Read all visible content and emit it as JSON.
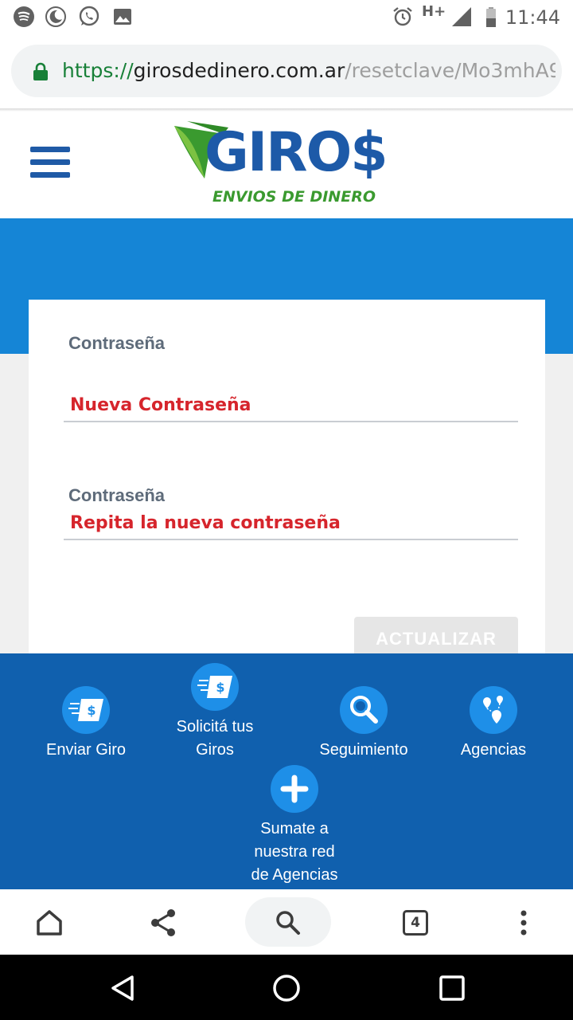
{
  "status_bar": {
    "time": "11:44",
    "network": "H+",
    "icons": [
      "spotify-icon",
      "night-mode-icon",
      "whatsapp-icon",
      "gallery-icon",
      "alarm-icon",
      "signal-icon",
      "battery-icon"
    ]
  },
  "browser": {
    "url_scheme": "https://",
    "url_host": "girosdedinero.com.ar",
    "url_path": "/resetclave/Mo3mhA9",
    "tab_count": "4"
  },
  "header": {
    "logo_text": "GIRO$",
    "logo_subtitle": "ENVIOS DE DINERO"
  },
  "form": {
    "field1_label": "Contraseña",
    "field1_placeholder": "Nueva Contraseña",
    "field2_label": "Contraseña",
    "field2_placeholder": "Repita la nueva contraseña",
    "submit_label": "ACTUALIZAR"
  },
  "bottom_nav": {
    "items": [
      {
        "label_line1": "Enviar Giro",
        "label_line2": ""
      },
      {
        "label_line1": "Solicitá tus",
        "label_line2": "Giros"
      },
      {
        "label_line1": "Seguimiento",
        "label_line2": ""
      },
      {
        "label_line1": "Agencias",
        "label_line2": ""
      },
      {
        "label_line1": "Sumate a",
        "label_line2": "nuestra red",
        "label_line3": "de Agencias"
      }
    ]
  },
  "colors": {
    "brand_blue": "#1060ae",
    "band_blue": "#1585d6",
    "logo_green": "#3a9a2f",
    "placeholder_red": "#d6252c"
  }
}
